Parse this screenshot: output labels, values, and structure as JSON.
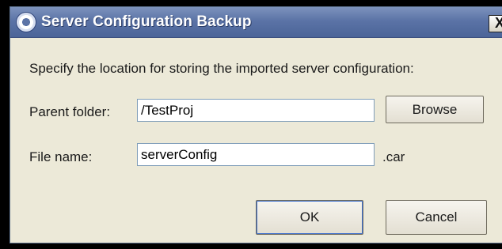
{
  "dialog": {
    "title": "Server Configuration Backup",
    "close_glyph": "X",
    "instruction": "Specify the location for storing the imported server configuration:"
  },
  "parent_folder": {
    "label": "Parent folder:",
    "value": "/TestProj",
    "browse_label": "Browse"
  },
  "file_name": {
    "label": "File name:",
    "value": "serverConfig",
    "extension": ".car"
  },
  "buttons": {
    "ok": "OK",
    "cancel": "Cancel"
  },
  "colors": {
    "titlebar": "#5b73a6",
    "dialog_bg": "#ece9d8",
    "input_border": "#7f9db9"
  }
}
